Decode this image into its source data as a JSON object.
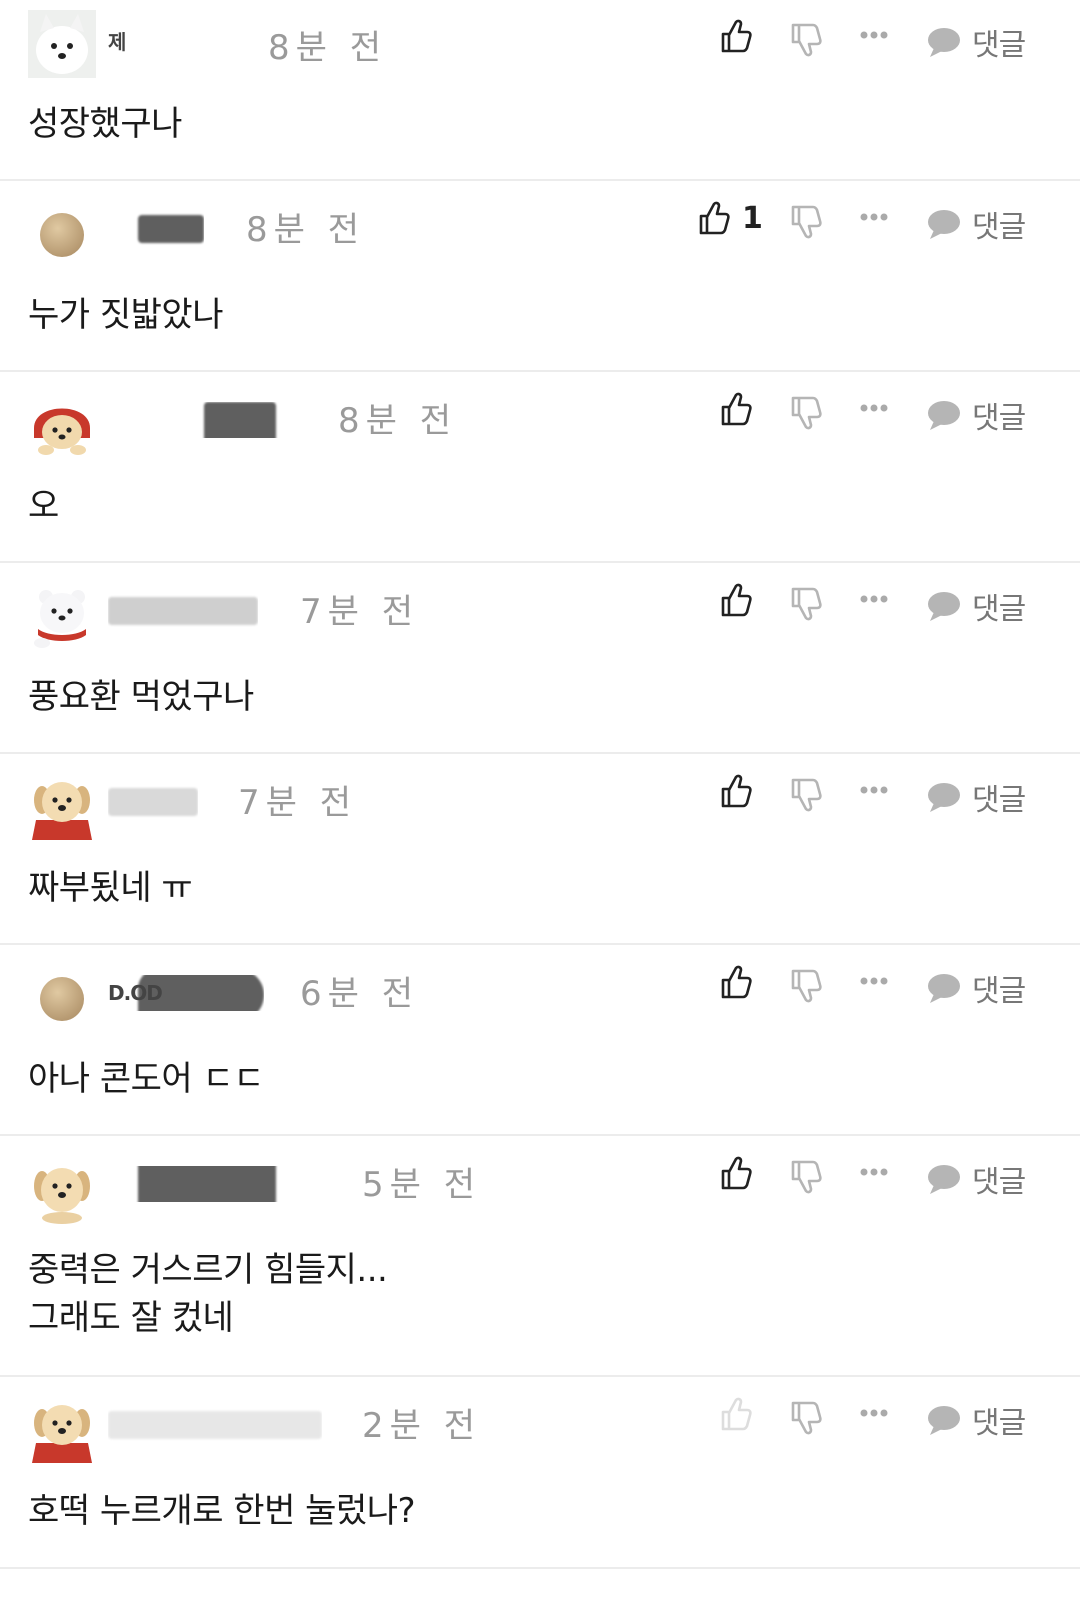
{
  "comments": [
    {
      "nick": "제",
      "avatar": "samoyed-avatar",
      "time": "8분 전",
      "likes": "",
      "text": "성장했구나",
      "reply": "댓글"
    },
    {
      "nick": "",
      "avatar": "beige-circle-avatar",
      "time": "8분 전",
      "likes": "1",
      "text": "누가 짓밟았나",
      "reply": "댓글"
    },
    {
      "nick": "",
      "avatar": "puppy-red-hood-avatar",
      "time": "8분 전",
      "likes": "",
      "text": "오",
      "reply": "댓글"
    },
    {
      "nick": "",
      "avatar": "white-bear-scarf-avatar",
      "time": "7분 전",
      "likes": "",
      "text": "풍요환 먹었구나",
      "reply": "댓글"
    },
    {
      "nick": "",
      "avatar": "puppy-red-cape-avatar",
      "time": "7분 전",
      "likes": "",
      "text": "짜부됬네 ㅠ",
      "reply": "댓글"
    },
    {
      "nick": "D.OD",
      "avatar": "beige-circle-avatar",
      "time": "6분 전",
      "likes": "",
      "text": "아나 콘도어 ㄷㄷ",
      "reply": "댓글"
    },
    {
      "nick": "",
      "avatar": "golden-puppy-avatar",
      "time": "5분 전",
      "likes": "",
      "text": "중력은 거스르기 힘들지...\n그래도 잘 컸네",
      "reply": "댓글"
    },
    {
      "nick": "",
      "avatar": "puppy-red-cape-avatar",
      "time": "2분 전",
      "likes": "",
      "text": "호떡 누르개로 한번 눌렀나?",
      "reply": "댓글"
    }
  ],
  "colors": {
    "text": "#1a1a1a",
    "time": "#9a9a9a",
    "icon": "#222222",
    "icon_muted": "#b5b5b5",
    "divider": "#ececec"
  }
}
